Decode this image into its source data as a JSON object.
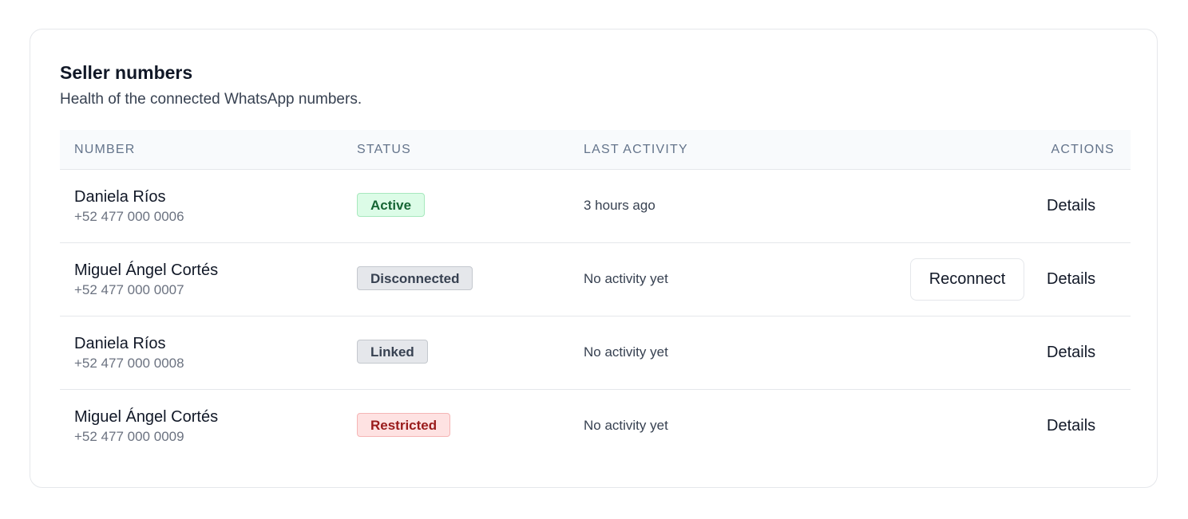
{
  "card": {
    "title": "Seller numbers",
    "subtitle": "Health of the connected WhatsApp numbers."
  },
  "table": {
    "headers": {
      "number": "NUMBER",
      "status": "STATUS",
      "activity": "LAST ACTIVITY",
      "actions": "ACTIONS"
    },
    "rows": [
      {
        "name": "Daniela Ríos",
        "phone": "+52 477 000 0006",
        "status": "Active",
        "status_color": "#166534",
        "last_activity": "3 hours ago",
        "actions": [
          "Details"
        ]
      },
      {
        "name": "Miguel Ángel Cortés",
        "phone": "+52 477 000 0007",
        "status": "Disconnected",
        "status_color": "#374151",
        "last_activity": "No activity yet",
        "reconnect_label": "Reconnect",
        "actions": [
          "Reconnect",
          "Details"
        ]
      },
      {
        "name": "Daniela Ríos",
        "phone": "+52 477 000 0008",
        "status": "Linked",
        "status_color": "#374151",
        "last_activity": "No activity yet",
        "actions": [
          "Details"
        ]
      },
      {
        "name": "Miguel Ángel Cortés",
        "phone": "+52 477 000 0009",
        "status": "Restricted",
        "status_color": "#991b1b",
        "last_activity": "No activity yet",
        "actions": [
          "Details"
        ]
      }
    ],
    "details_label": "Details"
  },
  "colors": {
    "active_badge_bg": "#dcfce7",
    "restricted_badge_bg": "#fee2e2",
    "neutral_badge_bg": "#e5e7eb",
    "header_bg": "#f8fafc"
  }
}
